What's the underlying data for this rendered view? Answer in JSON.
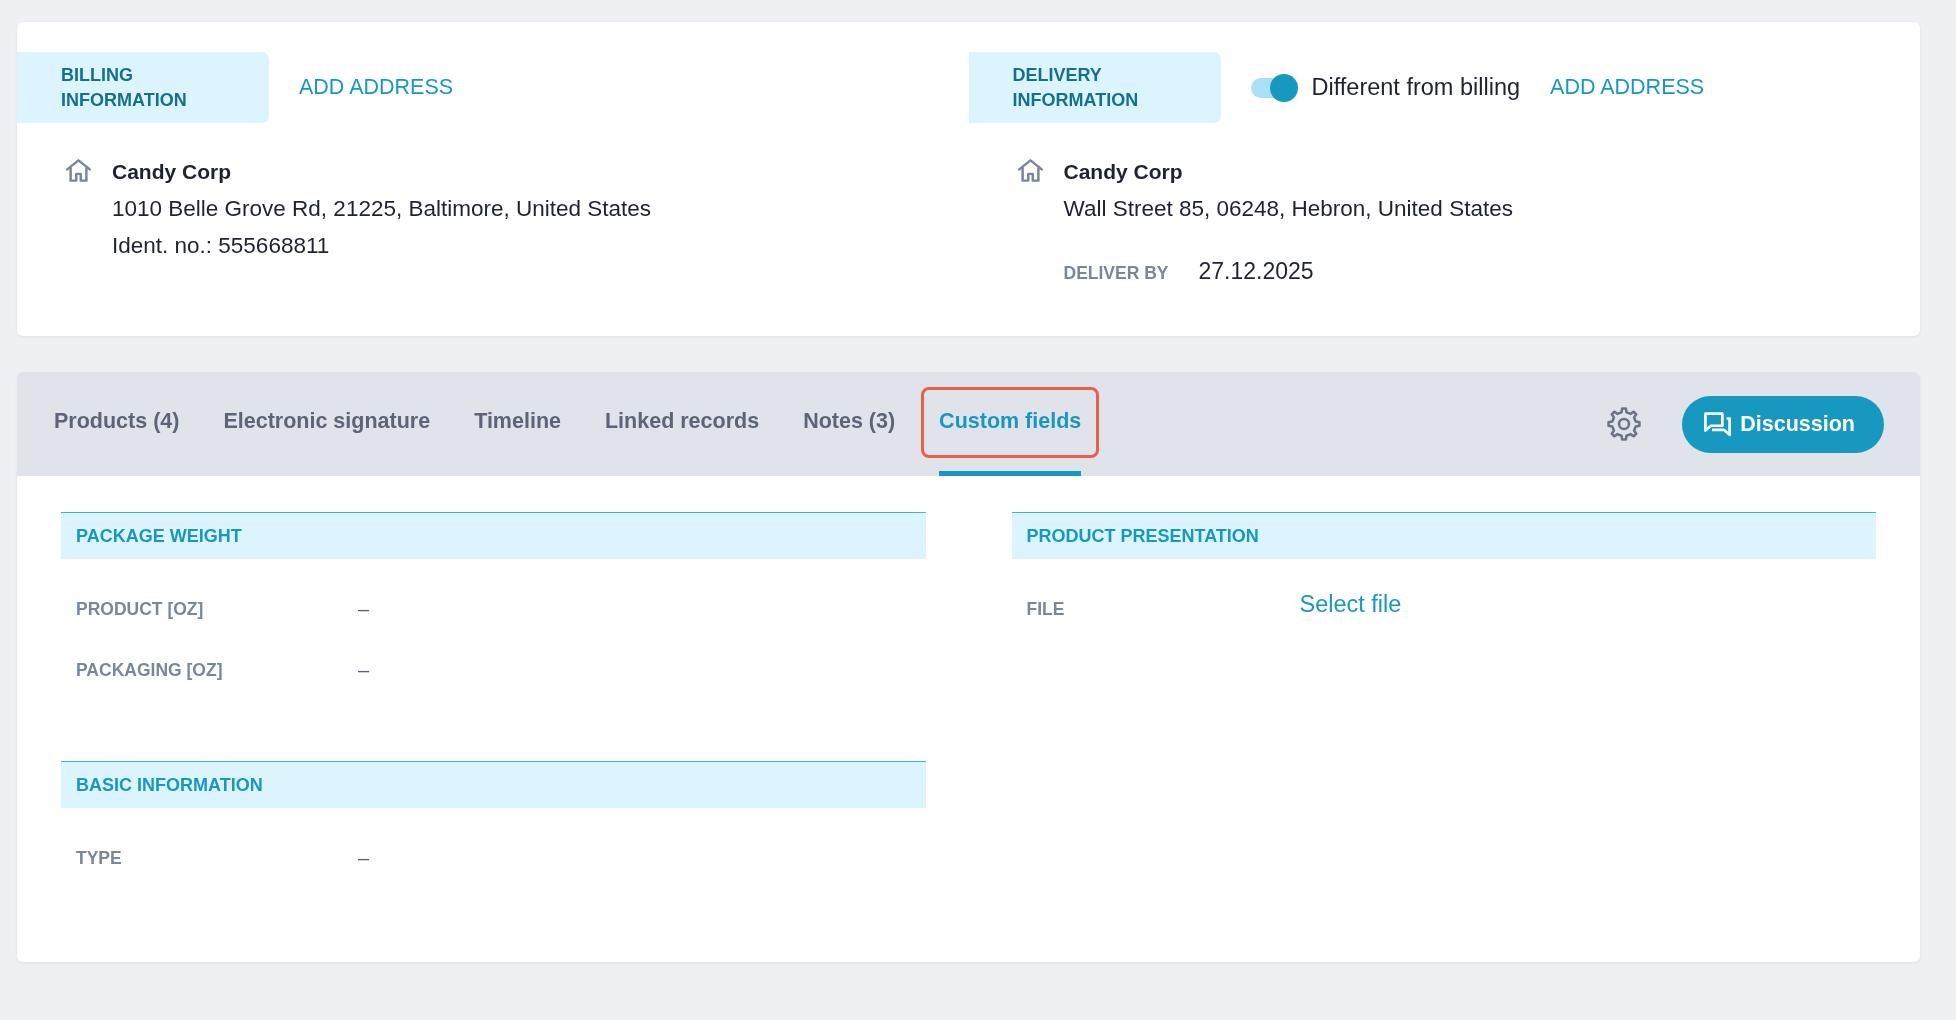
{
  "billing": {
    "title": "BILLING INFORMATION",
    "action": "ADD ADDRESS",
    "company": "Candy Corp",
    "lines": [
      "1010 Belle Grove Rd, 21225, Baltimore, United States",
      "Ident. no.: 555668811"
    ]
  },
  "delivery": {
    "title": "DELIVERY INFORMATION",
    "toggle": {
      "label": "Different from billing",
      "on": true
    },
    "action": "ADD ADDRESS",
    "company": "Candy Corp",
    "lines": [
      "Wall Street 85, 06248, Hebron, United States"
    ],
    "deliver_by": {
      "label": "DELIVER BY",
      "value": "27.12.2025"
    }
  },
  "tabs": [
    {
      "label": "Products (4)",
      "selected": false,
      "highlighted": false
    },
    {
      "label": "Electronic signature",
      "selected": false,
      "highlighted": false
    },
    {
      "label": "Timeline",
      "selected": false,
      "highlighted": false
    },
    {
      "label": "Linked records",
      "selected": false,
      "highlighted": false
    },
    {
      "label": "Notes (3)",
      "selected": false,
      "highlighted": false
    },
    {
      "label": "Custom fields",
      "selected": true,
      "highlighted": true
    }
  ],
  "toolbar": {
    "discussion_button": "Discussion"
  },
  "custom_fields": {
    "columns": [
      {
        "sections": [
          {
            "title": "PACKAGE WEIGHT",
            "fields": [
              {
                "kind": "text",
                "label": "PRODUCT [OZ]",
                "value": "–"
              },
              {
                "kind": "text",
                "label": "PACKAGING [OZ]",
                "value": "–"
              }
            ]
          },
          {
            "title": "BASIC INFORMATION",
            "fields": [
              {
                "kind": "text",
                "label": "TYPE",
                "value": "–"
              }
            ]
          }
        ]
      },
      {
        "sections": [
          {
            "title": "PRODUCT PRESENTATION",
            "fields": [
              {
                "kind": "link",
                "label": "FILE",
                "value": "Select file"
              }
            ]
          }
        ]
      }
    ]
  }
}
